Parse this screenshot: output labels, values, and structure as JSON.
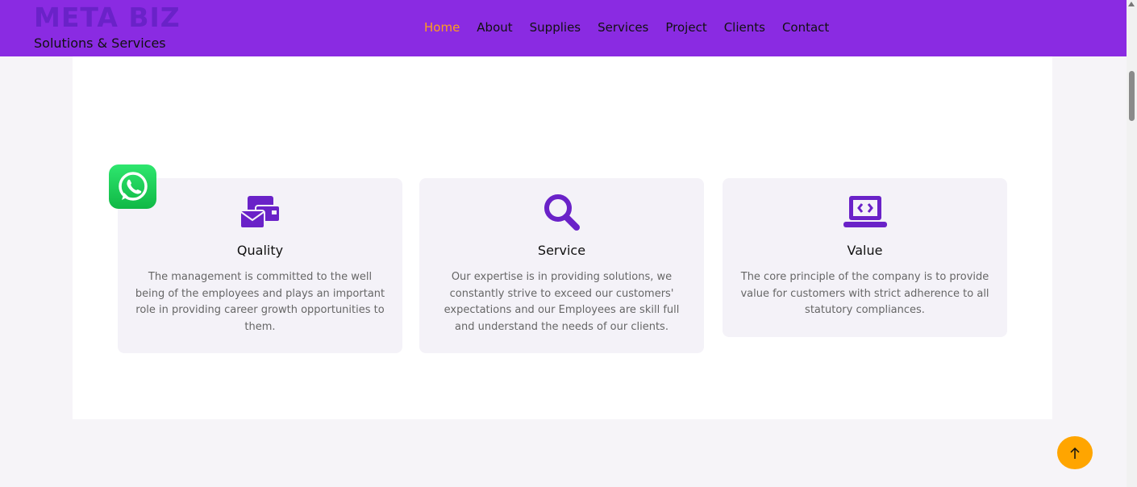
{
  "brand": {
    "title": "META BIZ",
    "subtitle": "Solutions & Services"
  },
  "nav": {
    "items": [
      {
        "label": "Home",
        "active": true
      },
      {
        "label": "About"
      },
      {
        "label": "Supplies"
      },
      {
        "label": "Services"
      },
      {
        "label": "Project"
      },
      {
        "label": "Clients"
      },
      {
        "label": "Contact"
      }
    ]
  },
  "features": [
    {
      "icon": "envelope-stack-icon",
      "title": "Quality",
      "text": "The management is committed to the well being of the employees and plays an important role in providing career growth opportunities to them."
    },
    {
      "icon": "search-icon",
      "title": "Service",
      "text": "Our expertise is in providing solutions, we constantly strive to exceed our customers' expectations and our Employees are skill full and understand the needs of our clients."
    },
    {
      "icon": "laptop-code-icon",
      "title": "Value",
      "text": "The core principle of the company is to provide value for customers with strict adherence to all statutory compliances."
    }
  ],
  "widgets": {
    "whatsapp_icon": "whatsapp-icon",
    "back_to_top_icon": "arrow-up-icon"
  },
  "colors": {
    "header_bg": "#8a2be2",
    "brand_title": "#6a22c8",
    "nav_active": "#ff9f1a",
    "icon_purple": "#6a22c8",
    "card_bg": "#f4f2f8",
    "back_top_bg": "#ffa500"
  }
}
